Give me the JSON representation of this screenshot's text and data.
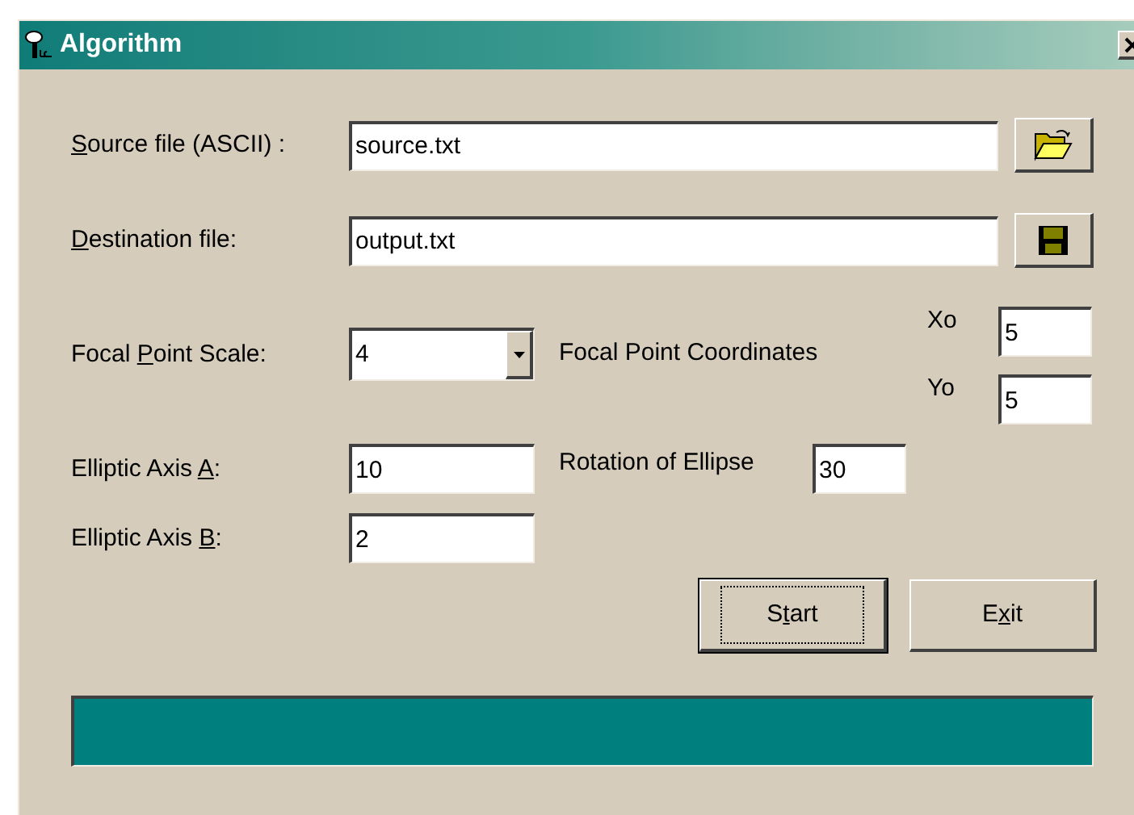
{
  "window": {
    "title": "Algorithm"
  },
  "file_rows": [
    {
      "kind": "open",
      "label": {
        "key": "S",
        "post": "ource file (ASCII) :"
      },
      "value": "source.txt"
    },
    {
      "kind": "save",
      "label": {
        "key": "D",
        "post": "estination file:"
      },
      "value": "output.txt"
    }
  ],
  "focal_point_scale": {
    "label": {
      "pre": "Focal ",
      "key": "P",
      "post": "oint Scale:"
    },
    "value": "4"
  },
  "focal_point_coordinates": {
    "label": "Focal Point Coordinates",
    "fields": [
      {
        "label": "Xo",
        "value": "5"
      },
      {
        "label": "Yo",
        "value": "5"
      }
    ]
  },
  "elliptic_axis_a": {
    "label": {
      "pre": "Elliptic Axis ",
      "key": "A",
      "post": ":"
    },
    "value": "10"
  },
  "rotation_of_ellipse": {
    "label": "Rotation of Ellipse",
    "value": "30"
  },
  "elliptic_axis_b": {
    "label": {
      "pre": "Elliptic Axis ",
      "key": "B",
      "post": ":"
    },
    "value": "2"
  },
  "buttons": [
    {
      "label": {
        "pre": "S",
        "key": "t",
        "post": "art"
      },
      "default": true
    },
    {
      "label": {
        "pre": "E",
        "key": "x",
        "post": "it"
      },
      "default": false
    }
  ],
  "progress": {
    "level": 1
  }
}
